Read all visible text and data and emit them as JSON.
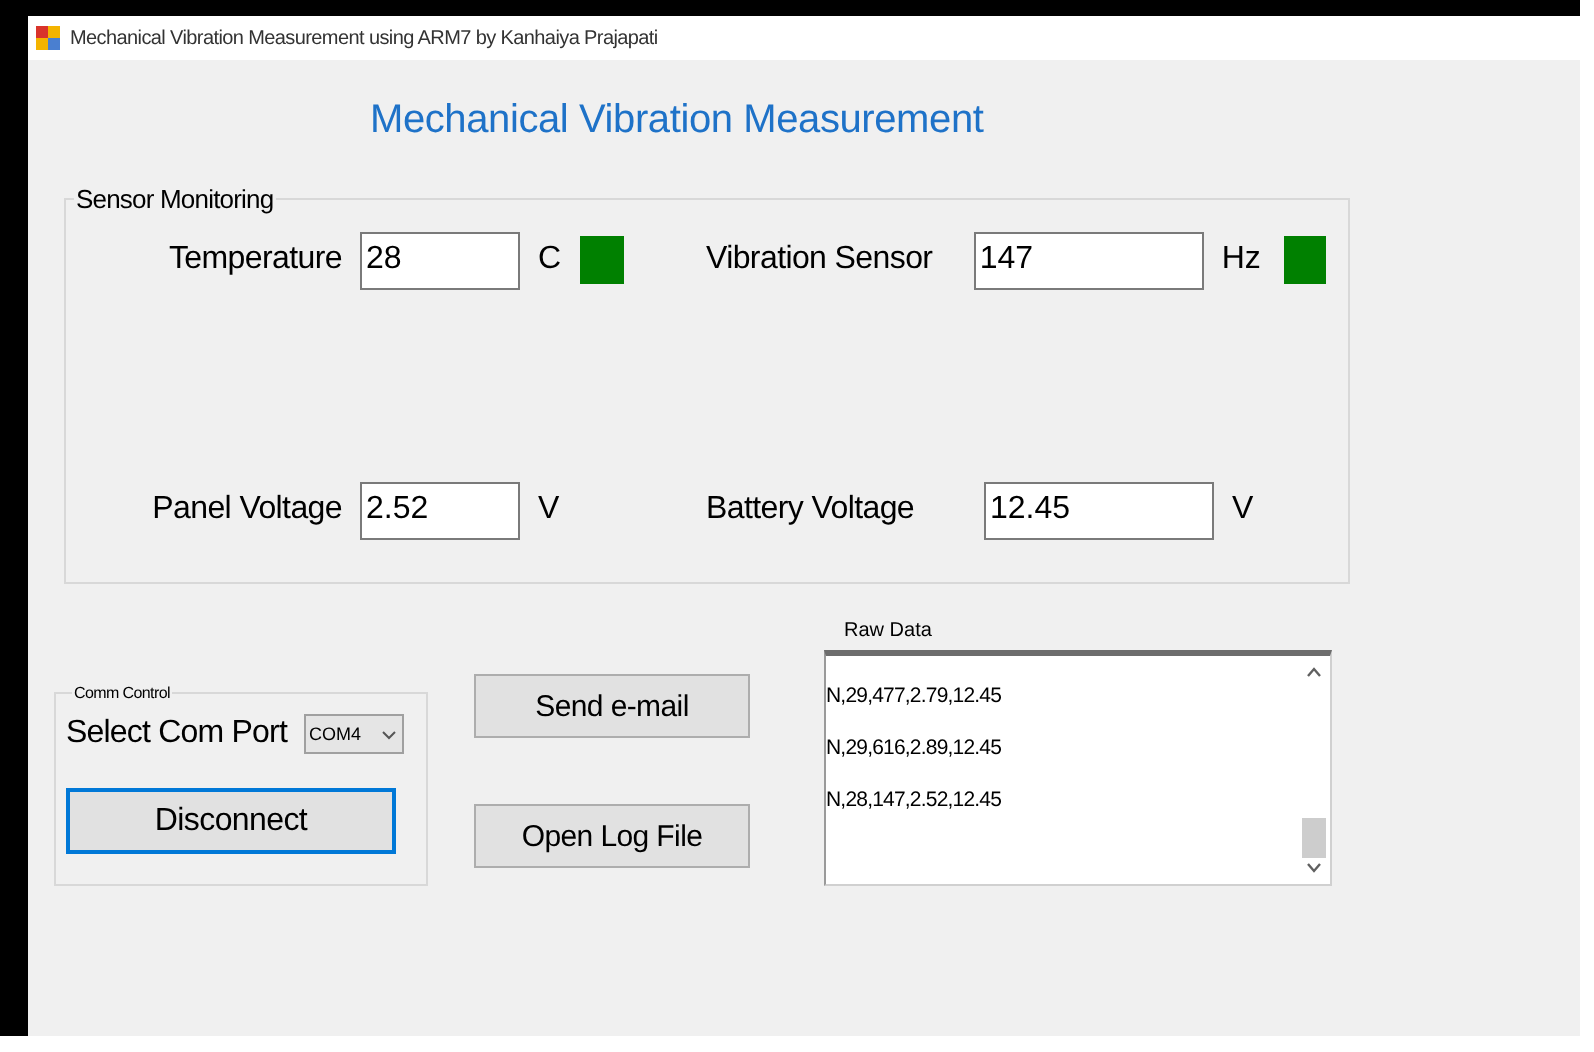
{
  "window": {
    "title": "Mechanical Vibration Measurement using ARM7 by Kanhaiya Prajapati"
  },
  "heading": "Mechanical Vibration Measurement",
  "sensor_monitoring": {
    "title": "Sensor Monitoring",
    "readings": [
      {
        "label": "Temperature",
        "value": "28",
        "unit": "C",
        "color": "#008000"
      },
      {
        "label": "Vibration Sensor",
        "value": "147",
        "unit": "Hz",
        "color": "#008000"
      },
      {
        "label": "Panel Voltage",
        "value": "2.52",
        "unit": "V"
      },
      {
        "label": "Battery Voltage",
        "value": "12.45",
        "unit": "V"
      }
    ]
  },
  "comm_control": {
    "title": "Comm Control",
    "port_label": "Select Com Port",
    "port": "COM4",
    "button": {
      "label": "Disconnect",
      "focused": true
    }
  },
  "buttons": [
    "Send e-mail",
    "Open Log File"
  ],
  "raw_data": {
    "label": "Raw Data",
    "lines": [
      "N,29,477,2.79,12.45",
      "N,29,616,2.89,12.45",
      "N,28,147,2.52,12.45"
    ]
  }
}
